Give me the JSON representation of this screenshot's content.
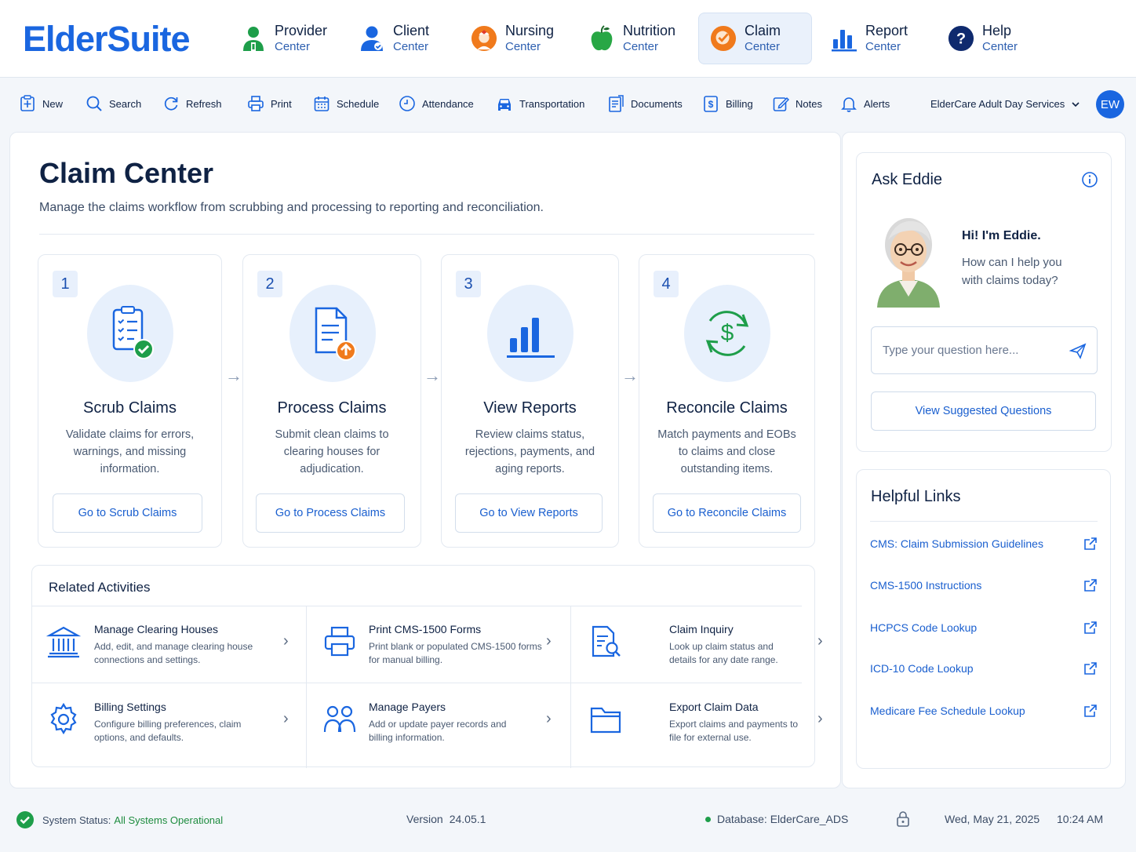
{
  "app": {
    "logo": "ElderSuite"
  },
  "modules": [
    {
      "title": "Provider",
      "sub": "Center",
      "icon": "provider-icon"
    },
    {
      "title": "Client",
      "sub": "Center",
      "icon": "client-icon"
    },
    {
      "title": "Nursing",
      "sub": "Center",
      "icon": "nursing-icon"
    },
    {
      "title": "Nutrition",
      "sub": "Center",
      "icon": "apple-icon"
    },
    {
      "title": "Claim",
      "sub": "Center",
      "icon": "claim-icon",
      "active": true
    },
    {
      "title": "Report",
      "sub": "Center",
      "icon": "bar-chart-icon"
    },
    {
      "title": "Help",
      "sub": "Center",
      "icon": "question-icon"
    }
  ],
  "toolbar": {
    "items": [
      {
        "label": "New",
        "icon": "new-icon"
      },
      {
        "label": "Search",
        "icon": "search-icon"
      },
      {
        "label": "Refresh",
        "icon": "refresh-icon"
      },
      {
        "label": "Print",
        "icon": "print-icon"
      },
      {
        "label": "Schedule",
        "icon": "calendar-icon"
      },
      {
        "label": "Attendance",
        "icon": "clock-icon"
      },
      {
        "label": "Transportation",
        "icon": "car-icon"
      },
      {
        "label": "Documents",
        "icon": "documents-icon"
      },
      {
        "label": "Billing",
        "icon": "billing-icon"
      },
      {
        "label": "Notes",
        "icon": "notes-icon"
      },
      {
        "label": "Alerts",
        "icon": "bell-icon"
      }
    ],
    "org": "ElderCare Adult Day Services",
    "avatar": "EW"
  },
  "page": {
    "title": "Claim Center",
    "subtitle": "Manage the claims workflow from scrubbing and processing to reporting and reconciliation."
  },
  "steps": [
    {
      "num": "1",
      "title": "Scrub Claims",
      "desc": "Validate claims for errors, warnings, and missing information.",
      "button": "Go to Scrub Claims"
    },
    {
      "num": "2",
      "title": "Process Claims",
      "desc": "Submit clean claims to clearing houses for adjudication.",
      "button": "Go to Process Claims"
    },
    {
      "num": "3",
      "title": "View Reports",
      "desc": "Review claims status, rejections, payments, and aging reports.",
      "button": "Go to View Reports"
    },
    {
      "num": "4",
      "title": "Reconcile Claims",
      "desc": "Match payments and EOBs to claims and close outstanding items.",
      "button": "Go to Reconcile Claims"
    }
  ],
  "related": {
    "title": "Related Activities",
    "items": [
      {
        "title": "Manage Clearing Houses",
        "desc": "Add, edit, and manage clearing house connections and settings."
      },
      {
        "title": "Print CMS-1500 Forms",
        "desc": "Print blank or populated CMS-1500 forms for manual billing."
      },
      {
        "title": "Claim Inquiry",
        "desc": "Look up claim status and details for any date range."
      },
      {
        "title": "Billing Settings",
        "desc": "Configure billing preferences, claim options, and defaults."
      },
      {
        "title": "Manage Payers",
        "desc": "Add or update payer records and billing information."
      },
      {
        "title": "Export Claim Data",
        "desc": "Export claims and payments to file for external use."
      }
    ]
  },
  "eddie": {
    "title": "Ask Eddie",
    "greeting": "Hi! I'm Eddie.",
    "message": "How can I help you with claims today?",
    "placeholder": "Type your question here...",
    "suggest": "View Suggested Questions"
  },
  "links": {
    "title": "Helpful Links",
    "items": [
      "CMS: Claim Submission Guidelines",
      "CMS-1500 Instructions",
      "HCPCS Code Lookup",
      "ICD-10 Code Lookup",
      "Medicare Fee Schedule Lookup"
    ]
  },
  "status": {
    "label": "System Status:",
    "value": "All Systems Operational",
    "version_label": "Version",
    "version": "24.05.1",
    "database": "Database: ElderCare_ADS",
    "date": "Wed, May 21, 2025",
    "time": "10:24 AM"
  },
  "colors": {
    "accent": "#1a66e0",
    "success": "#1e9e4a",
    "orange": "#f07a1c"
  }
}
